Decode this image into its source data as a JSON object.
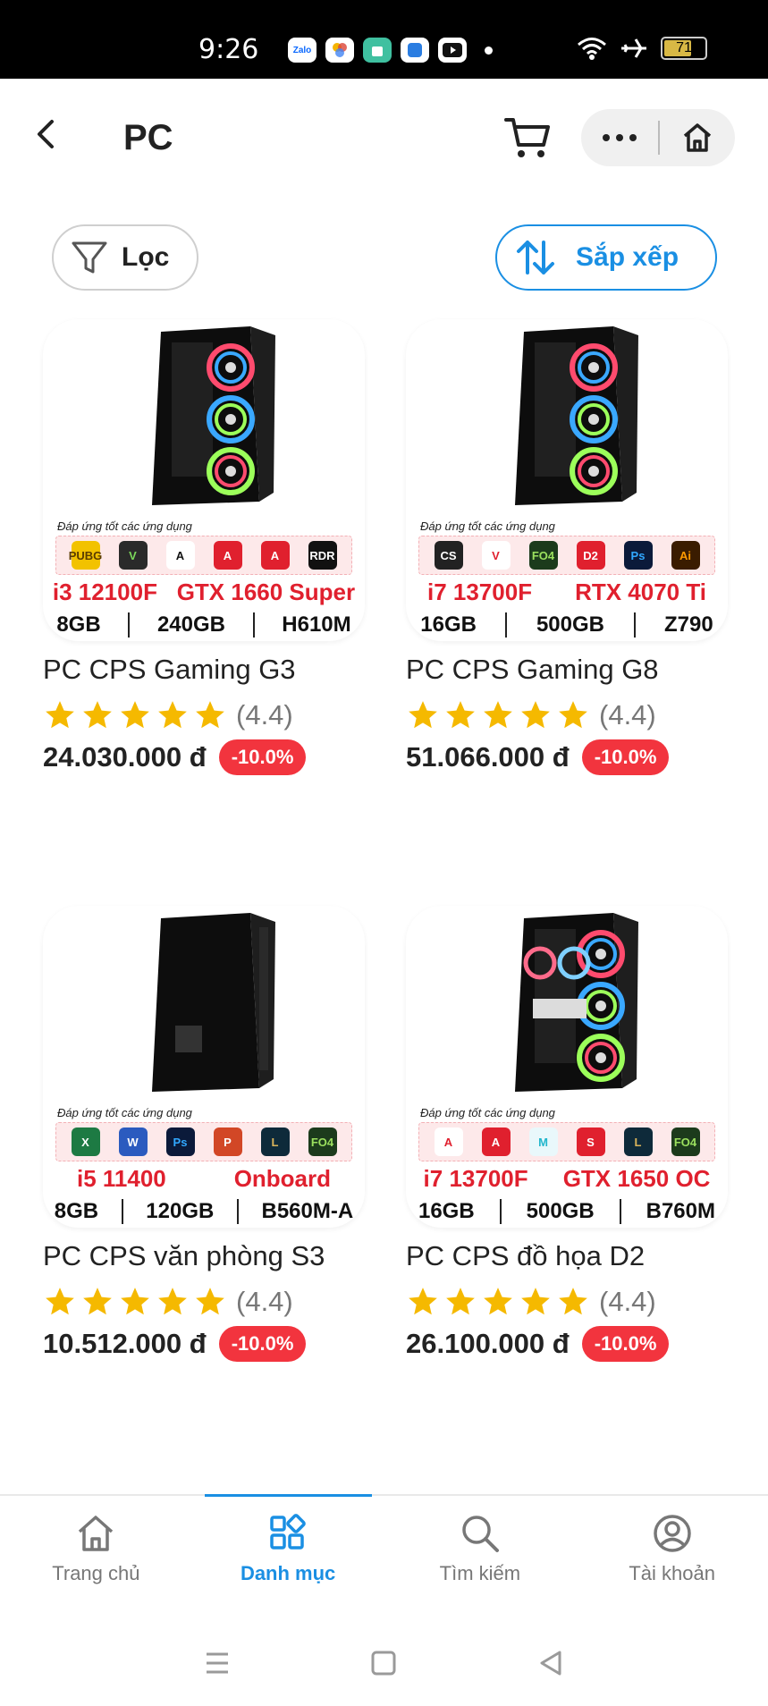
{
  "status_bar": {
    "time": "9:26",
    "apps": [
      "Zalo",
      "photos",
      "shop",
      "app",
      "youtube"
    ],
    "battery": "71",
    "battery_level_percent": 71
  },
  "header": {
    "title": "PC",
    "back_icon": "chevron-left-icon",
    "cart_icon": "cart-icon",
    "home_icon": "home-icon"
  },
  "toolbar": {
    "filter_label": "Lọc",
    "sort_label": "Sắp xếp"
  },
  "colors": {
    "accent": "#1a8fe3",
    "discount": "#f2343e",
    "star": "#f5b900",
    "spec_red": "#e0202e"
  },
  "products": [
    {
      "name": "PC CPS Gaming G3",
      "rating": "(4.4)",
      "price": "24.030.000 đ",
      "discount": "-10.0%",
      "image": {
        "apps_caption": "Đáp ứng tốt các ứng dụng",
        "apps": [
          "PUBG",
          "GTA V",
          "Apex",
          "Adobe",
          "Adobe",
          "RED DEAD REDEMPTION"
        ],
        "cpu": "i3 12100F",
        "gpu": "GTX 1660 Super",
        "ram": "8GB",
        "storage": "240GB",
        "board": "H610M"
      }
    },
    {
      "name": "PC CPS Gaming G8",
      "rating": "(4.4)",
      "price": "51.066.000 đ",
      "discount": "-10.0%",
      "image": {
        "apps_caption": "Đáp ứng tốt các ứng dụng",
        "apps": [
          "CS",
          "VALORANT",
          "FO4",
          "Dota 2",
          "Ps",
          "Ai"
        ],
        "cpu": "i7 13700F",
        "gpu": "RTX 4070 Ti",
        "ram": "16GB",
        "storage": "500GB",
        "board": "Z790"
      }
    },
    {
      "name": "PC CPS văn phòng S3",
      "rating": "(4.4)",
      "price": "10.512.000 đ",
      "discount": "-10.0%",
      "image": {
        "apps_caption": "Đáp ứng tốt các ứng dụng",
        "apps": [
          "Excel",
          "Word",
          "Ps",
          "PowerPoint",
          "LoL",
          "FO4"
        ],
        "cpu": "i5 11400",
        "gpu": "Onboard",
        "ram": "8GB",
        "storage": "120GB",
        "board": "B560M-A"
      }
    },
    {
      "name": "PC CPS đồ họa D2",
      "rating": "(4.4)",
      "price": "26.100.000 đ",
      "discount": "-10.0%",
      "image": {
        "apps_caption": "Đáp ứng tốt các ứng dụng",
        "apps": [
          "Autodesk",
          "Adobe",
          "Maya",
          "SketchUp",
          "LoL",
          "FO4"
        ],
        "cpu": "i7 13700F",
        "gpu": "GTX 1650 OC",
        "ram": "16GB",
        "storage": "500GB",
        "board": "B760M"
      }
    }
  ],
  "tabbar": {
    "items": [
      {
        "label": "Trang chủ",
        "icon": "home-icon"
      },
      {
        "label": "Danh mục",
        "icon": "category-icon",
        "active": true
      },
      {
        "label": "Tìm kiếm",
        "icon": "search-icon"
      },
      {
        "label": "Tài khoản",
        "icon": "account-icon"
      }
    ]
  },
  "system_nav": [
    "menu-icon",
    "square-home-icon",
    "triangle-back-icon"
  ]
}
